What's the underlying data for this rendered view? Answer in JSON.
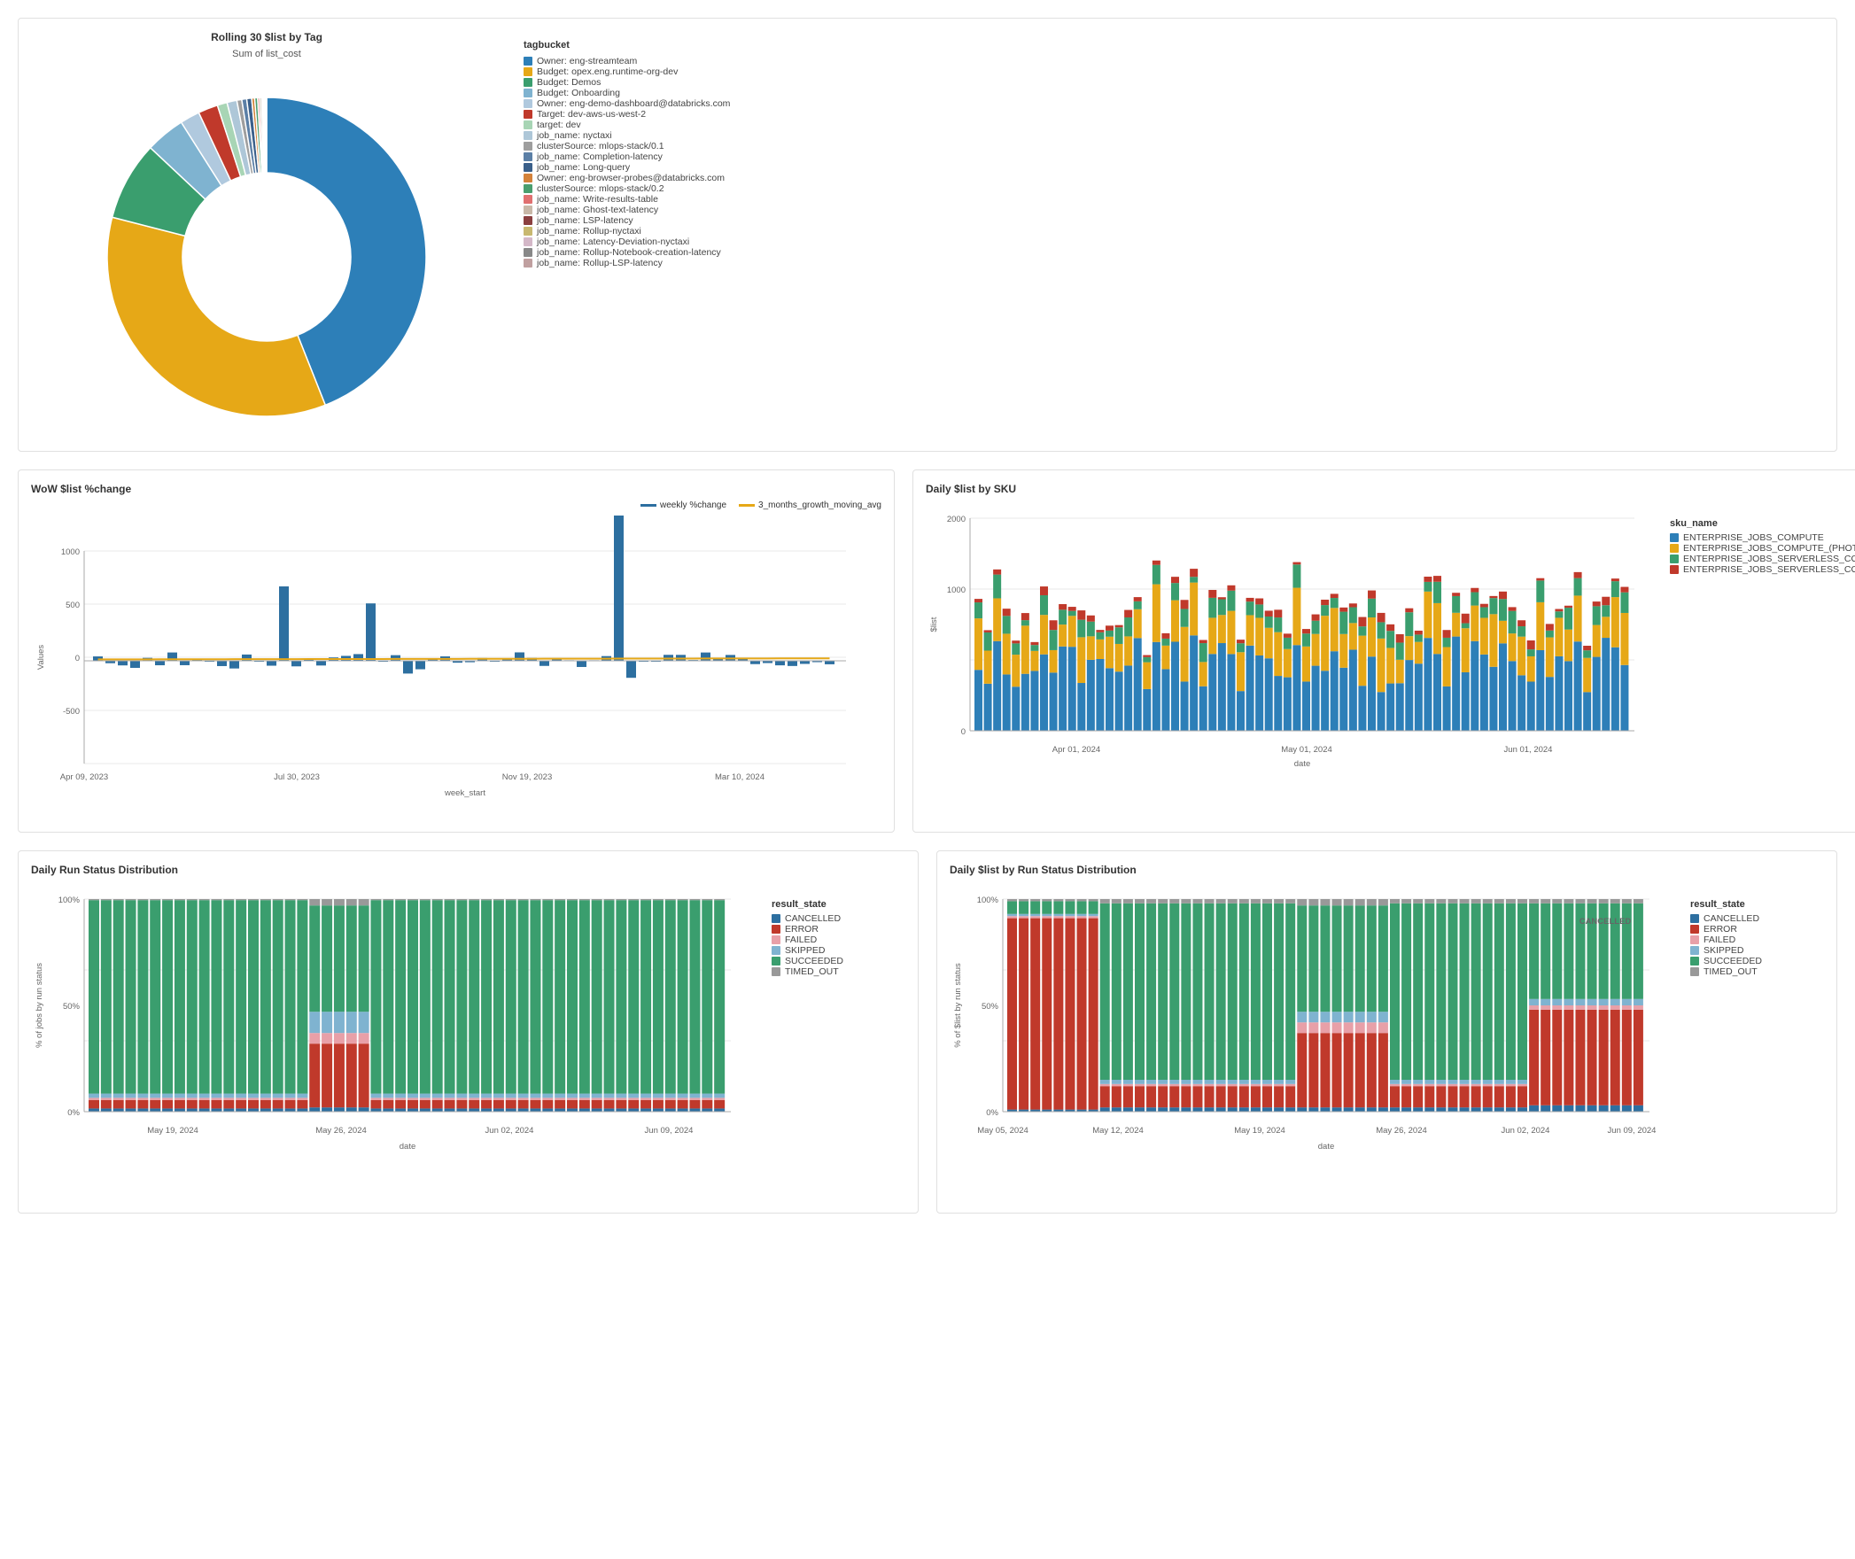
{
  "top": {
    "title": "Rolling 30 $list by Tag",
    "subtitle": "Sum of list_cost",
    "legend_title": "tagbucket",
    "legend_items": [
      {
        "label": "Owner: eng-streamteam",
        "color": "#2d7fb8"
      },
      {
        "label": "Budget: opex.eng.runtime-org-dev",
        "color": "#e6a817"
      },
      {
        "label": "Budget: Demos",
        "color": "#3a9e6e"
      },
      {
        "label": "Budget: Onboarding",
        "color": "#7fb3d0"
      },
      {
        "label": "Owner: eng-demo-dashboard@databricks.com",
        "color": "#b0c9de"
      },
      {
        "label": "Target: dev-aws-us-west-2",
        "color": "#c0392b"
      },
      {
        "label": "target: dev",
        "color": "#a8d5b5"
      },
      {
        "label": "job_name: nyctaxi",
        "color": "#aec7d8"
      },
      {
        "label": "clusterSource: mlops-stack/0.1",
        "color": "#9e9e9e"
      },
      {
        "label": "job_name: Completion-latency",
        "color": "#5b7fa6"
      },
      {
        "label": "job_name: Long-query",
        "color": "#3a5f8a"
      },
      {
        "label": "Owner: eng-browser-probes@databricks.com",
        "color": "#d4823a"
      },
      {
        "label": "clusterSource: mlops-stack/0.2",
        "color": "#4a9e6e"
      },
      {
        "label": "job_name: Write-results-table",
        "color": "#e07070"
      },
      {
        "label": "job_name: Ghost-text-latency",
        "color": "#c8b8a8"
      },
      {
        "label": "job_name: LSP-latency",
        "color": "#8b4040"
      },
      {
        "label": "job_name: Rollup-nyctaxi",
        "color": "#c8b870"
      },
      {
        "label": "job_name: Latency-Deviation-nyctaxi",
        "color": "#d4b8c8"
      },
      {
        "label": "job_name: Rollup-Notebook-creation-latency",
        "color": "#888888"
      },
      {
        "label": "job_name: Rollup-LSP-latency",
        "color": "#c0a0a0"
      }
    ],
    "donut": {
      "segments": [
        {
          "pct": 0.44,
          "color": "#2d7fb8"
        },
        {
          "pct": 0.35,
          "color": "#e6a817"
        },
        {
          "pct": 0.08,
          "color": "#3a9e6e"
        },
        {
          "pct": 0.04,
          "color": "#7fb3d0"
        },
        {
          "pct": 0.02,
          "color": "#b0c9de"
        },
        {
          "pct": 0.02,
          "color": "#c0392b"
        },
        {
          "pct": 0.01,
          "color": "#a8d5b5"
        },
        {
          "pct": 0.01,
          "color": "#aec7d8"
        },
        {
          "pct": 0.005,
          "color": "#9e9e9e"
        },
        {
          "pct": 0.005,
          "color": "#5b7fa6"
        },
        {
          "pct": 0.005,
          "color": "#3a5f8a"
        },
        {
          "pct": 0.003,
          "color": "#d4823a"
        },
        {
          "pct": 0.003,
          "color": "#4a9e6e"
        },
        {
          "pct": 0.002,
          "color": "#e07070"
        },
        {
          "pct": 0.002,
          "color": "#c8b8a8"
        },
        {
          "pct": 0.001,
          "color": "#8b4040"
        },
        {
          "pct": 0.001,
          "color": "#c8b870"
        },
        {
          "pct": 0.001,
          "color": "#d4b8c8"
        },
        {
          "pct": 0.001,
          "color": "#888888"
        },
        {
          "pct": 0.001,
          "color": "#c0a0a0"
        }
      ]
    }
  },
  "wow": {
    "title": "WoW $list %change",
    "x_label": "week_start",
    "y_label": "Values",
    "legend_items": [
      {
        "label": "weekly %change",
        "color": "#2d6fa0"
      },
      {
        "label": "3_months_growth_moving_avg",
        "color": "#e6a817"
      }
    ],
    "x_ticks": [
      "Apr 09, 2023",
      "Jul 30, 2023",
      "Nov 19, 2023",
      "Mar 10, 2024"
    ],
    "y_ticks": [
      "-500",
      "0",
      "500",
      "1000"
    ]
  },
  "daily_sku": {
    "title": "Daily $list by SKU",
    "x_label": "date",
    "y_label": "$list",
    "legend_title": "sku_name",
    "legend_items": [
      {
        "label": "ENTERPRISE_JOBS_COMPUTE",
        "color": "#2d7fb8"
      },
      {
        "label": "ENTERPRISE_JOBS_COMPUTE_(PHOTON)",
        "color": "#e6a817"
      },
      {
        "label": "ENTERPRISE_JOBS_SERVERLESS_COMPUTE_U...",
        "color": "#3a9e6e"
      },
      {
        "label": "ENTERPRISE_JOBS_SERVERLESS_COMPUTE_U...",
        "color": "#c0392b"
      }
    ],
    "x_ticks": [
      "Apr 01, 2024",
      "May 01, 2024",
      "Jun 01, 2024"
    ],
    "y_ticks": [
      "0",
      "1000",
      "2000"
    ]
  },
  "daily_status": {
    "title": "Daily Run Status Distribution",
    "x_label": "date",
    "y_label": "% of jobs by run status",
    "legend_title": "result_state",
    "legend_items": [
      {
        "label": "CANCELLED",
        "color": "#2d6fa0"
      },
      {
        "label": "ERROR",
        "color": "#c0392b"
      },
      {
        "label": "FAILED",
        "color": "#e8a0a8"
      },
      {
        "label": "SKIPPED",
        "color": "#7fb3d0"
      },
      {
        "label": "SUCCEEDED",
        "color": "#3a9e6e"
      },
      {
        "label": "TIMED_OUT",
        "color": "#999999"
      }
    ],
    "x_ticks": [
      "May 19, 2024",
      "May 26, 2024",
      "Jun 02, 2024",
      "Jun 09, 2024"
    ],
    "y_ticks": [
      "0%",
      "50%",
      "100%"
    ]
  },
  "daily_list_status": {
    "title": "Daily $list by Run Status Distribution",
    "x_label": "date",
    "y_label": "% of $list by run status",
    "legend_title": "result_state",
    "legend_items": [
      {
        "label": "CANCELLED",
        "color": "#2d6fa0"
      },
      {
        "label": "ERROR",
        "color": "#c0392b"
      },
      {
        "label": "FAILED",
        "color": "#e8a0a8"
      },
      {
        "label": "SKIPPED",
        "color": "#7fb3d0"
      },
      {
        "label": "SUCCEEDED",
        "color": "#3a9e6e"
      },
      {
        "label": "TIMED_OUT",
        "color": "#999999"
      }
    ],
    "x_ticks": [
      "May 05, 2024",
      "May 12, 2024",
      "May 19, 2024",
      "May 26, 2024",
      "Jun 02, 2024",
      "Jun 09, 2024"
    ],
    "y_ticks": [
      "0%",
      "50%",
      "100%"
    ],
    "cancelled_label": "CANCELLED"
  }
}
